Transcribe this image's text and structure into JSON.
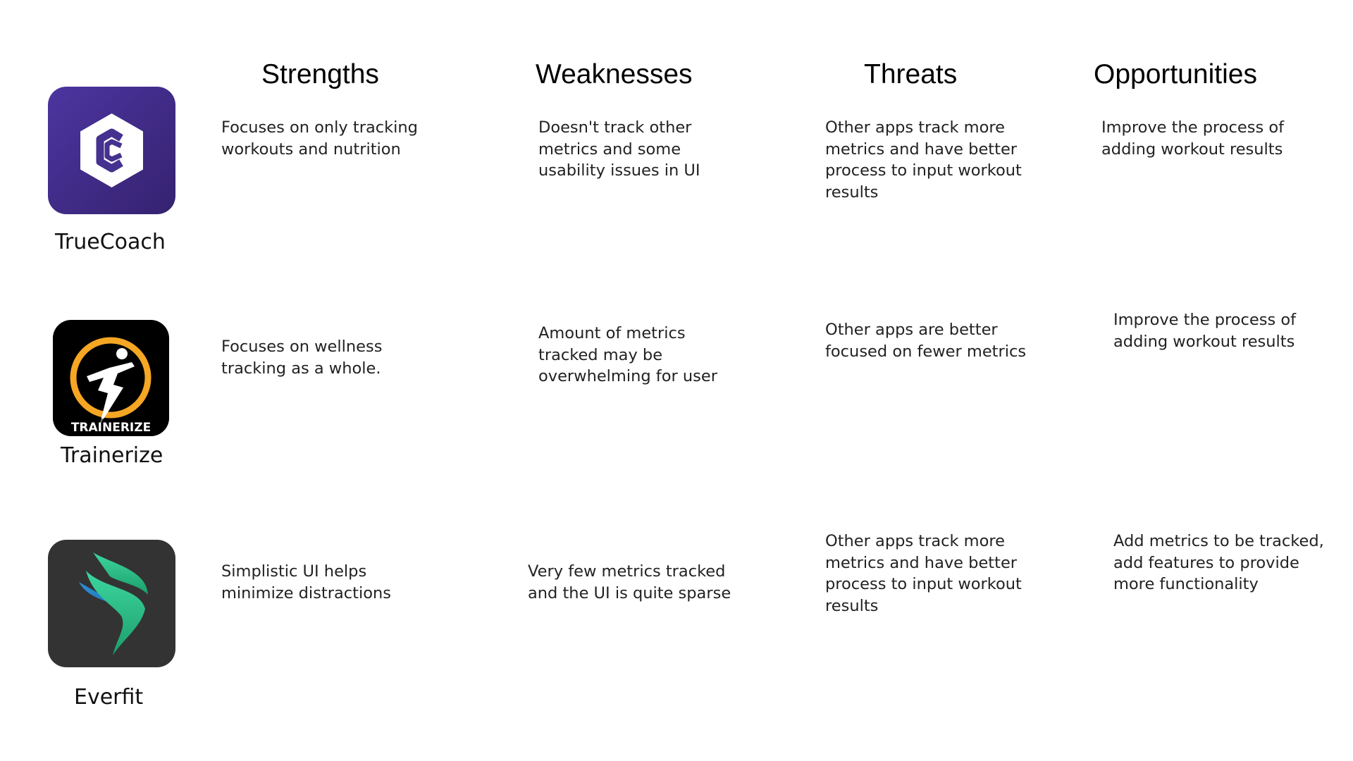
{
  "headers": {
    "strengths": "Strengths",
    "weaknesses": "Weaknesses",
    "threats": "Threats",
    "opportunities": "Opportunities"
  },
  "apps": [
    {
      "name": "TrueCoach",
      "icon": "truecoach-logo-icon",
      "icon_bg": "#45318f",
      "strengths": [
        "Focuses on only tracking",
        "workouts and nutrition"
      ],
      "weaknesses": [
        "Doesn't track other",
        "metrics and some",
        "usability issues in UI"
      ],
      "threats": [
        "Other apps track more",
        "metrics and have better",
        "process to input workout",
        "results"
      ],
      "opportunities": [
        "Improve the process of",
        "adding workout results"
      ]
    },
    {
      "name": "Trainerize",
      "icon": "trainerize-logo-icon",
      "icon_bg": "#000000",
      "icon_accent": "#f5a623",
      "icon_text": "TRAINERIZE",
      "strengths": [
        "Focuses on wellness",
        "tracking as a whole."
      ],
      "weaknesses": [
        "Amount of metrics",
        "tracked may be",
        "overwhelming for user"
      ],
      "threats": [
        "Other apps  are better",
        "focused on fewer metrics"
      ],
      "opportunities": [
        "Improve the process of",
        "adding workout results"
      ]
    },
    {
      "name": "Everfit",
      "icon": "everfit-logo-icon",
      "icon_bg": "#333333",
      "icon_accent": "#2bc48a",
      "strengths": [
        "Simplistic UI helps",
        "minimize distractions"
      ],
      "weaknesses": [
        "Very few metrics tracked",
        "and the UI is quite sparse"
      ],
      "threats": [
        "Other apps track more",
        "metrics and have better",
        "process to input workout",
        "results"
      ],
      "opportunities": [
        "Add metrics to be tracked,",
        "add features to provide",
        "more functionality"
      ]
    }
  ]
}
